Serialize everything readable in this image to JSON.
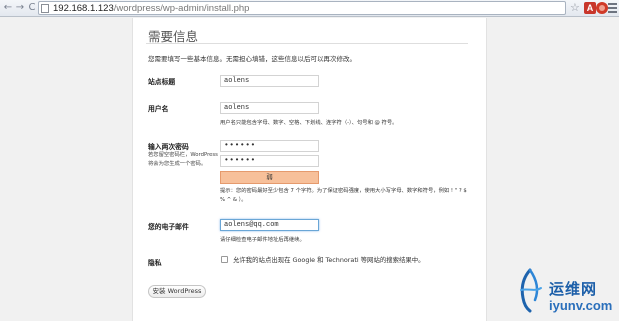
{
  "browser": {
    "url_host": "192.168.1.123",
    "url_path": "/wordpress/wp-admin/install.php",
    "nav_back": "←",
    "nav_forward": "→",
    "nav_reload": "C",
    "star": "☆",
    "extension_a": "A"
  },
  "form": {
    "heading": "需要信息",
    "intro": "您需要填写一些基本信息。无需担心填错，这些信息以后可以再次修改。",
    "site_title": {
      "label": "站点标题",
      "value": "aolens"
    },
    "username": {
      "label": "用户名",
      "value": "aolens",
      "description": "用户名只能包含字母、数字、空格、下划线、连字符（-）、句号和 @ 符号。"
    },
    "password": {
      "label": "输入两次密码",
      "hint": "若您留空密码栏，WordPress 将会为您生成一个密码。",
      "value1": "••••••",
      "value2": "••••••",
      "strength": "弱",
      "tip": "提示：您的密码最好至少包含 7 个字符。为了保证密码强度，使用大小写字母、数字和符号，例如 ! \" ? $ % ^ & ）。"
    },
    "email": {
      "label": "您的电子邮件",
      "value": "aolens@qq.com",
      "description": "请仔细检查电子邮件地址后再继续。"
    },
    "privacy": {
      "label": "隐私",
      "checkbox_text": "允许我的站点出现在 Google 和 Technorati 等网站的搜索结果中。",
      "checked": false
    },
    "install_button": "安装 WordPress"
  },
  "watermark": {
    "cn": "运维网",
    "url": "iyunv.com"
  }
}
